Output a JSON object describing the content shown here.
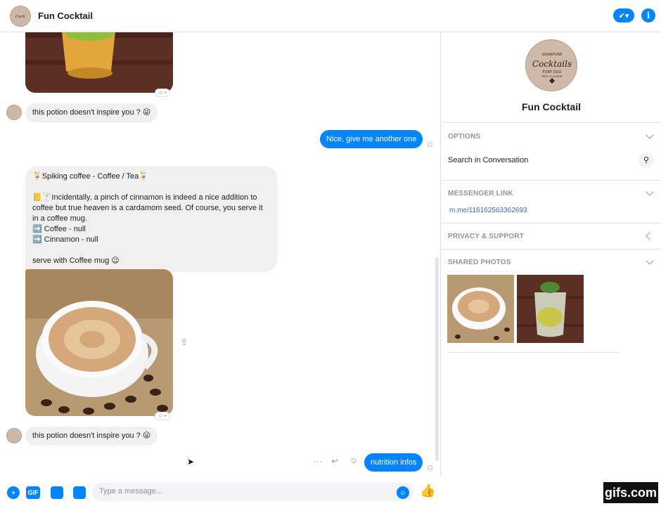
{
  "header": {
    "title": "Fun Cocktail"
  },
  "messages": {
    "in1": "this potion doesn't inspire you ? 😜",
    "out1": "Nice, give me another one",
    "card": {
      "line1": "🍹Spiking coffee - Coffee / Tea🍹",
      "line2": "📒🍸Incidentally, a pinch of cinnamon is indeed a nice addition to",
      "line3": "coffee but true heaven is a cardamom seed. Of course, you serve it",
      "line4": "in a coffee mug.",
      "line5": "➡️ Coffee - null",
      "line6": "➡️ Cinnamon - null",
      "line7": "serve with Coffee mug 😉"
    },
    "in2": "this potion doesn't inspire you ? 😜",
    "out2": "nutrition infos"
  },
  "composer": {
    "placeholder": "Type a message...",
    "gif_label": "GIF"
  },
  "sidebar": {
    "logo": {
      "l1": "SIGNATURE",
      "l2": "Cocktails",
      "l3": "FONT DUO",
      "l4": "FREE TO CLIPART"
    },
    "name": "Fun Cocktail",
    "options_label": "OPTIONS",
    "search_label": "Search in Conversation",
    "link_label": "MESSENGER LINK",
    "link_value": "m.me/116162563362693",
    "privacy_label": "PRIVACY & SUPPORT",
    "photos_label": "SHARED PHOTOS"
  },
  "watermark": "gifs.com",
  "colors": {
    "accent": "#0084ff",
    "incoming": "#f1f0f0"
  }
}
